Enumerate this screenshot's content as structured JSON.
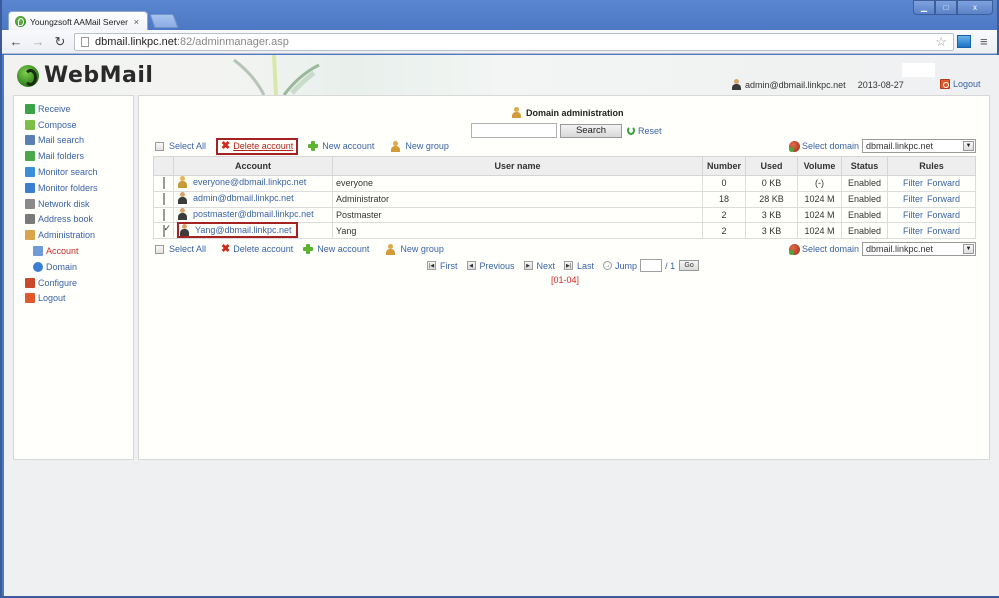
{
  "browser": {
    "tab_title": "Youngzsoft AAMail Server",
    "tab_close": "×",
    "url_host": "dbmail.linkpc.net",
    "url_rest": ":82/adminmanager.asp",
    "window_controls": {
      "minimize": "▁",
      "maximize": "□",
      "close": "x"
    }
  },
  "header": {
    "logo_text": "WebMail",
    "user": "admin@dbmail.linkpc.net",
    "date": "2013-08-27",
    "logout": "Logout"
  },
  "sidebar": {
    "items": [
      {
        "label": "Receive",
        "icon": "receive-icon",
        "color": "#3aa34a"
      },
      {
        "label": "Compose",
        "icon": "compose-icon",
        "color": "#7bbf4a"
      },
      {
        "label": "Mail search",
        "icon": "search-icon",
        "color": "#5a7fb0"
      },
      {
        "label": "Mail folders",
        "icon": "folders-icon",
        "color": "#4aa84a"
      },
      {
        "label": "Monitor search",
        "icon": "monitor-search-icon",
        "color": "#3b8fd6"
      },
      {
        "label": "Monitor folders",
        "icon": "monitor-folders-icon",
        "color": "#3b7fd0"
      },
      {
        "label": "Network disk",
        "icon": "disk-icon",
        "color": "#8a8a8a"
      },
      {
        "label": "Address book",
        "icon": "address-book-icon",
        "color": "#7a7a7a"
      },
      {
        "label": "Administration",
        "icon": "admin-icon",
        "color": "#d9a54a"
      },
      {
        "label": "Account",
        "icon": "account-icon",
        "color": "#6f9ad6",
        "sub": true,
        "active": true
      },
      {
        "label": "Domain",
        "icon": "domain-globe-icon",
        "color": "#3a7fd6",
        "sub": true
      },
      {
        "label": "Configure",
        "icon": "configure-icon",
        "color": "#c84a2a"
      },
      {
        "label": "Logout",
        "icon": "logout-icon",
        "color": "#e0582c"
      }
    ]
  },
  "main": {
    "title": "Domain administration",
    "search": {
      "value": "",
      "button": "Search",
      "reset": "Reset"
    },
    "actions": {
      "select_all": "Select All",
      "delete_account": "Delete account",
      "new_account": "New account",
      "new_group": "New group",
      "select_domain": "Select domain",
      "domain_value": "dbmail.linkpc.net"
    },
    "table": {
      "headers": [
        "",
        "Account",
        "User name",
        "Number",
        "Used",
        "Volume",
        "Status",
        "Rules"
      ],
      "rows": [
        {
          "checked": false,
          "account": "everyone@dbmail.linkpc.net",
          "type": "group",
          "username": "everyone",
          "number": "0",
          "used": "0 KB",
          "volume": "(-)",
          "status": "Enabled",
          "filter": "Filter",
          "forward": "Forward"
        },
        {
          "checked": false,
          "account": "admin@dbmail.linkpc.net",
          "type": "user",
          "username": "Administrator",
          "number": "18",
          "used": "28 KB",
          "volume": "1024 M",
          "status": "Enabled",
          "filter": "Filter",
          "forward": "Forward"
        },
        {
          "checked": false,
          "account": "postmaster@dbmail.linkpc.net",
          "type": "user",
          "username": "Postmaster",
          "number": "2",
          "used": "3 KB",
          "volume": "1024 M",
          "status": "Enabled",
          "filter": "Filter",
          "forward": "Forward"
        },
        {
          "checked": true,
          "account": "Yang@dbmail.linkpc.net",
          "type": "user",
          "username": "Yang",
          "number": "2",
          "used": "3 KB",
          "volume": "1024 M",
          "status": "Enabled",
          "filter": "Filter",
          "forward": "Forward"
        }
      ]
    },
    "pager": {
      "first": "First",
      "previous": "Previous",
      "next": "Next",
      "last": "Last",
      "jump": "Jump",
      "jump_value": "",
      "total": "/ 1",
      "go": "Go",
      "range": "[01-04]"
    }
  }
}
